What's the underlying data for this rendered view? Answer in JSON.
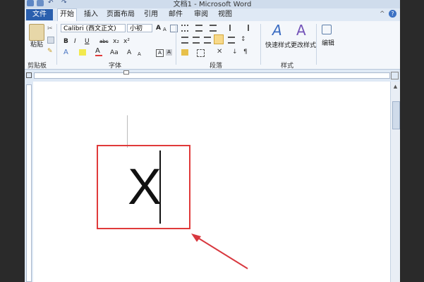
{
  "window": {
    "title": "文档1 - Microsoft Word"
  },
  "tabs": [
    {
      "label": "文件"
    },
    {
      "label": "开始"
    },
    {
      "label": "插入"
    },
    {
      "label": "页面布局"
    },
    {
      "label": "引用"
    },
    {
      "label": "邮件"
    },
    {
      "label": "审阅"
    },
    {
      "label": "视图"
    }
  ],
  "ribbon": {
    "clipboard": {
      "paste_label": "粘贴",
      "group_label": "剪贴板"
    },
    "font": {
      "font_name": "Calibri (西文正文)",
      "font_size": "小初",
      "group_label": "字体",
      "bold": "B",
      "italic": "I",
      "underline": "U",
      "strike": "abc",
      "subscript": "x₂",
      "superscript": "x²",
      "change_case": "Aa",
      "grow": "A",
      "shrink": "A"
    },
    "paragraph": {
      "group_label": "段落"
    },
    "styles": {
      "quick_styles_label": "快速样式",
      "change_styles_label": "更改样式",
      "group_label": "样式"
    },
    "editing": {
      "label": "编辑"
    }
  },
  "document": {
    "box_letter": "X"
  },
  "colors": {
    "file_tab": "#2a5fae",
    "highlight_border": "#e03a3a",
    "arrow": "#d8383f"
  }
}
